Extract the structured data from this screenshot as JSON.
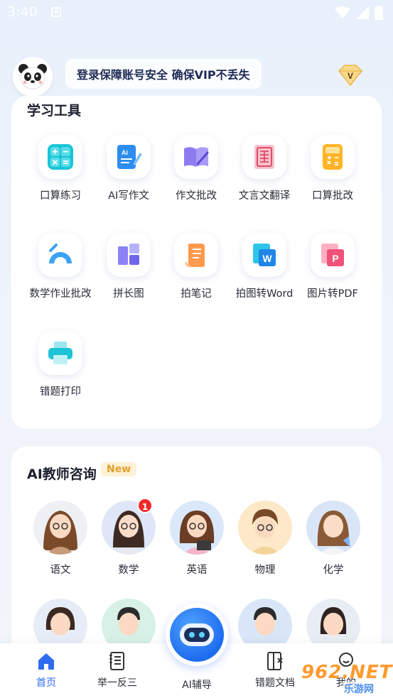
{
  "status_bar": {
    "time": "3:40",
    "notif": "A"
  },
  "header": {
    "notice": "登录保障账号安全 确保VIP不丢失",
    "vip_letter": "V"
  },
  "tools": {
    "title": "学习工具",
    "items": [
      {
        "label": "口算练习",
        "icon": "calculator-grid-icon"
      },
      {
        "label": "AI写作文",
        "icon": "ai-writing-icon"
      },
      {
        "label": "作文批改",
        "icon": "open-book-pen-icon"
      },
      {
        "label": "文言文翻译",
        "icon": "classical-text-icon"
      },
      {
        "label": "口算批改",
        "icon": "calculator-icon"
      },
      {
        "label": "数学作业批改",
        "icon": "protractor-icon"
      },
      {
        "label": "拼长图",
        "icon": "stitch-image-icon"
      },
      {
        "label": "拍笔记",
        "icon": "scroll-note-icon"
      },
      {
        "label": "拍图转Word",
        "icon": "word-doc-icon"
      },
      {
        "label": "图片转PDF",
        "icon": "pdf-doc-icon"
      },
      {
        "label": "错题打印",
        "icon": "printer-icon"
      }
    ]
  },
  "ai_teachers": {
    "title": "AI教师咨询",
    "badge": "New",
    "items": [
      {
        "label": "语文",
        "badge": ""
      },
      {
        "label": "数学",
        "badge": "1"
      },
      {
        "label": "英语",
        "badge": ""
      },
      {
        "label": "物理",
        "badge": ""
      },
      {
        "label": "化学",
        "badge": ""
      }
    ]
  },
  "nav": {
    "home": "首页",
    "analogy": "举一反三",
    "ai": "AI辅导",
    "wrong_docs": "错题文档",
    "mine": "我的"
  },
  "watermark": {
    "text": "962.NET",
    "sub": "乐游网"
  },
  "colors": {
    "accent": "#2f6cf0",
    "badge_red": "#f02a2a",
    "new_bg": "#fdf1d6",
    "new_text": "#e2a12a"
  }
}
